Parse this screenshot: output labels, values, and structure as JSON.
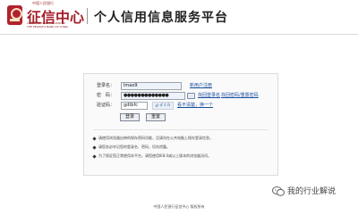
{
  "header": {
    "tagline_top": "中国人民银行",
    "brand_name": "征信中心",
    "brand_en": [
      "CREDIT REFERENCE CENTER",
      "THE PEOPLE'S BANK OF CHINA"
    ],
    "platform_title": "个人信用信息服务平台"
  },
  "login": {
    "username_label": "登录名：",
    "username_value": "lmao9",
    "register_link": "新用户注册",
    "password_label": "密　码：",
    "password_value": "●●●●●●●●●●●●●",
    "forgot_login_link": "找回登录名",
    "forgot_password_link": "找回密码/重置密码",
    "captcha_label": "验证码：",
    "captcha_value": "gdtbfc",
    "captcha_image_text": "g d t b",
    "refresh_captcha_link": "看不清楚，换一个",
    "login_button": "登录",
    "reset_button": "重置"
  },
  "notices": [
    "请使用浏览器自带的保存密码功能，且请勿在公共电脑上保存登录信息。",
    "请您务必牢记您的登录名、密码，切勿泄露。",
    "为了保证您正常使用本平台，请您使用IE8.0或以上版本的浏览器访问。"
  ],
  "watermark": {
    "text": "我的行业解说"
  },
  "footer": {
    "text": "中国人民银行征信中心 版权所有"
  },
  "colors": {
    "brand_red": "#a51f2a",
    "link_blue": "#1b4fa0"
  }
}
